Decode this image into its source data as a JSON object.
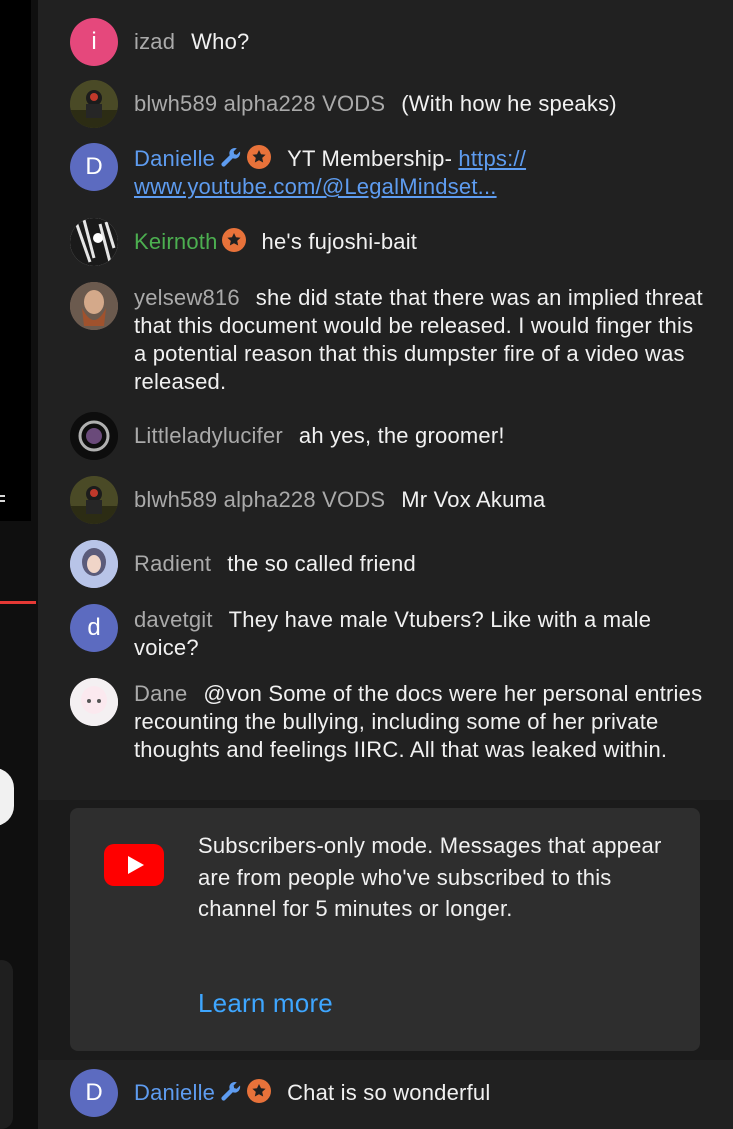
{
  "chat": {
    "messages": [
      {
        "author": "izad",
        "text": "Who?",
        "avatar_letter": "i",
        "avatar_color": "#e5487c"
      },
      {
        "author": "blwh589 alpha228 VODS",
        "text": "(With how he speaks)"
      },
      {
        "author": "Danielle",
        "text": "YT Membership- ",
        "link": "https:// www.youtube.com/@LegalMindset...",
        "avatar_letter": "D",
        "avatar_color": "#5c6bc0",
        "badges": [
          "wrench-icon",
          "star-badge-icon"
        ]
      },
      {
        "author": "Keirnoth",
        "text": "he's fujoshi-bait",
        "badges": [
          "star-badge-icon"
        ]
      },
      {
        "author": "yelsew816",
        "text": "she did state that there was an implied threat that this document would be released. I would finger this a potential reason that this dumpster fire of a video was released."
      },
      {
        "author": "Littleladylucifer",
        "text": "ah yes, the groomer!"
      },
      {
        "author": "blwh589 alpha228 VODS",
        "text": "Mr Vox Akuma"
      },
      {
        "author": "Radient",
        "text": "the so called friend"
      },
      {
        "author": "davetgit",
        "text": "They have male Vtubers? Like with a male voice?",
        "avatar_letter": "d",
        "avatar_color": "#5c6bc0"
      },
      {
        "author": "Dane",
        "text": "@von Some of the docs were her personal entries recounting the bullying, including some of her private thoughts and feelings IIRC. All that was leaked within."
      }
    ],
    "subscriber_notice": {
      "text": "Subscribers-only mode. Messages that appear are from people who've subscribed to this channel for 5 minutes or longer.",
      "learn_more": "Learn more"
    },
    "last_message": {
      "author": "Danielle",
      "text": "Chat is so wonderful",
      "avatar_letter": "D",
      "avatar_color": "#5c6bc0"
    }
  },
  "colors": {
    "moderator": "#5e9cf0",
    "member": "#4caf50",
    "badge_orange": "#e8723a",
    "accent_link": "#3ea6ff"
  }
}
